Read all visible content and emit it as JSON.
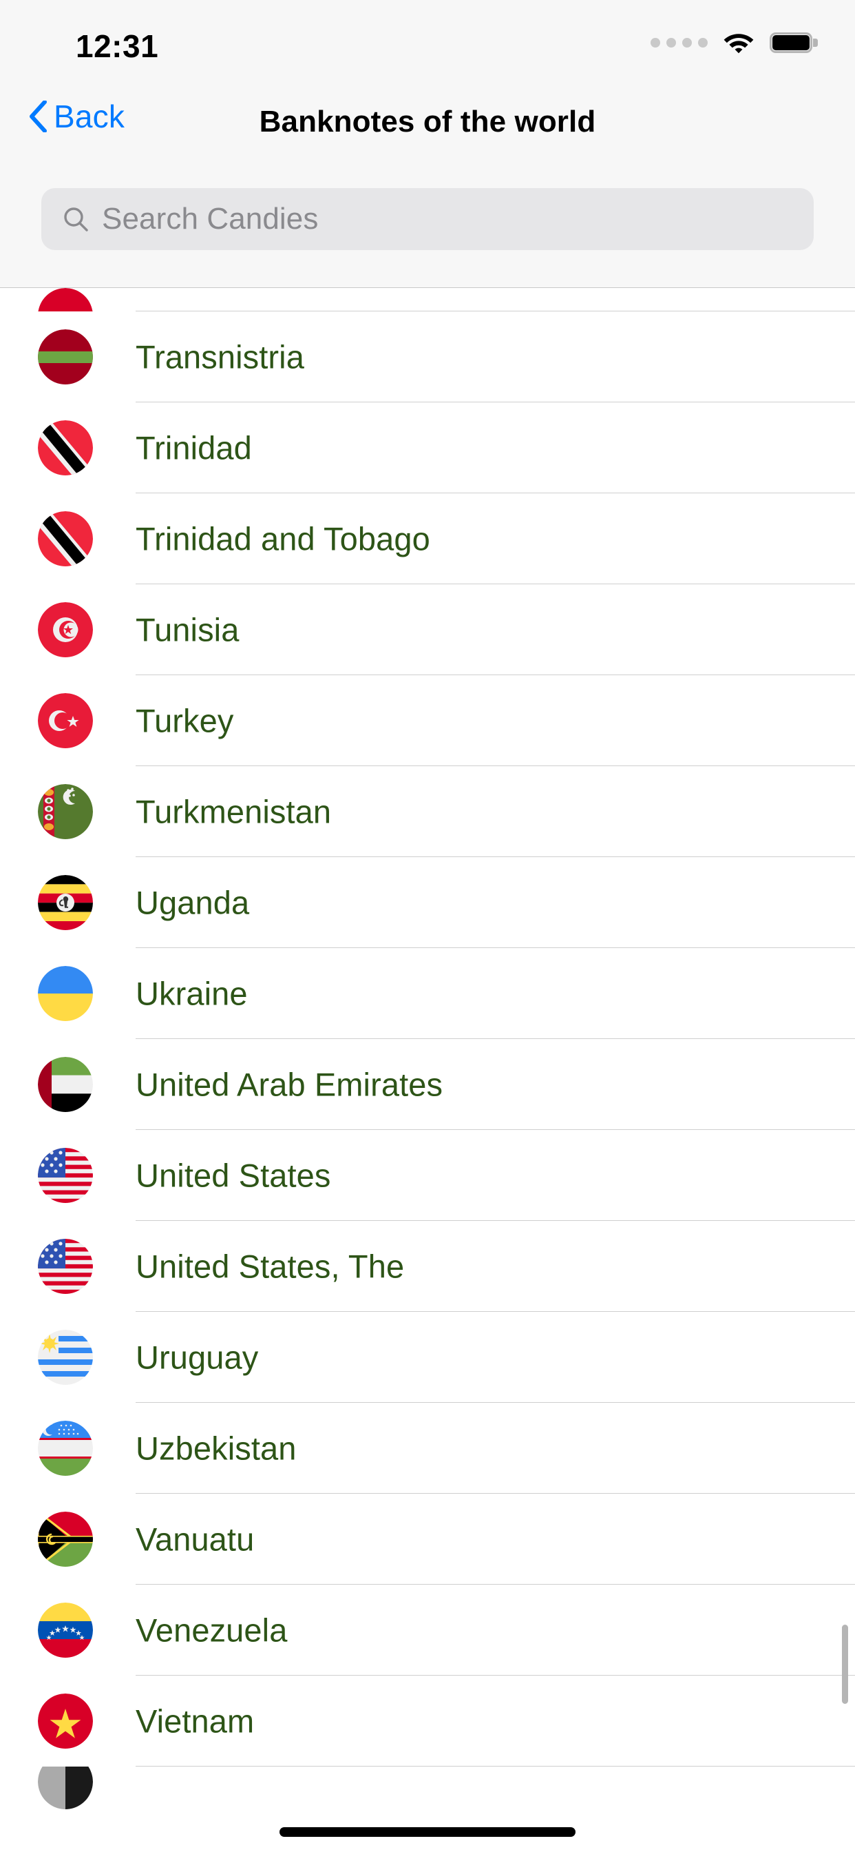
{
  "status_bar": {
    "time": "12:31",
    "signal_icon": "cellular-dots-icon",
    "wifi_icon": "wifi-icon",
    "battery_icon": "battery-full-icon",
    "dots_count": 4
  },
  "nav_bar": {
    "back_label": "Back",
    "back_icon": "chevron-left-icon",
    "title": "Banknotes of the world",
    "accent_color": "#007aff"
  },
  "search": {
    "icon": "search-icon",
    "placeholder": "Search Candies",
    "value": ""
  },
  "list": {
    "text_color": "#2d5417",
    "separator_color": "#cfcfcf",
    "rows": [
      {
        "label": "Transnistria",
        "flag": "transnistria-flag-icon"
      },
      {
        "label": "Trinidad",
        "flag": "trinidad-flag-icon"
      },
      {
        "label": "Trinidad and Tobago",
        "flag": "trinidad-and-tobago-flag-icon"
      },
      {
        "label": "Tunisia",
        "flag": "tunisia-flag-icon"
      },
      {
        "label": "Turkey",
        "flag": "turkey-flag-icon"
      },
      {
        "label": "Turkmenistan",
        "flag": "turkmenistan-flag-icon"
      },
      {
        "label": "Uganda",
        "flag": "uganda-flag-icon"
      },
      {
        "label": "Ukraine",
        "flag": "ukraine-flag-icon"
      },
      {
        "label": "United Arab Emirates",
        "flag": "united-arab-emirates-flag-icon"
      },
      {
        "label": "United States",
        "flag": "united-states-flag-icon"
      },
      {
        "label": "United States, The",
        "flag": "united-states-flag-icon"
      },
      {
        "label": "Uruguay",
        "flag": "uruguay-flag-icon"
      },
      {
        "label": "Uzbekistan",
        "flag": "uzbekistan-flag-icon"
      },
      {
        "label": "Vanuatu",
        "flag": "vanuatu-flag-icon"
      },
      {
        "label": "Venezuela",
        "flag": "venezuela-flag-icon"
      },
      {
        "label": "Vietnam",
        "flag": "vietnam-flag-icon"
      }
    ]
  },
  "scrollbar": {
    "visible": true
  },
  "home_indicator": {
    "visible": true
  }
}
